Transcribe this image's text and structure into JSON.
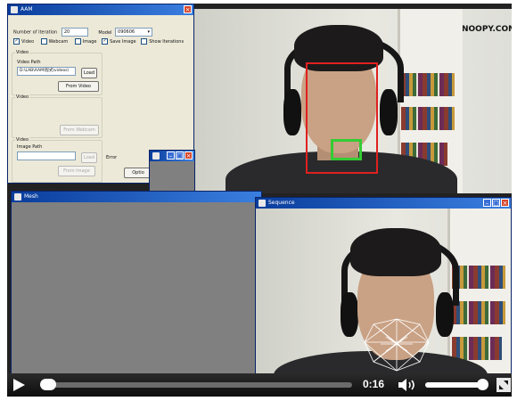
{
  "aam_window": {
    "title": "AAM",
    "iterations_label": "Number of iteration",
    "iterations_value": "20",
    "model_label": "Model",
    "model_value": "090606",
    "checkboxes": [
      {
        "label": "Video",
        "checked": true
      },
      {
        "label": "Webcam",
        "checked": false
      },
      {
        "label": "Image",
        "checked": false
      },
      {
        "label": "Save Image",
        "checked": true
      },
      {
        "label": "Show Iterations",
        "checked": false
      }
    ],
    "video_group_label": "Video",
    "video_path_label": "Video Path",
    "video_path_value": "D:\\LAB\\AAM\\程式\\videos\\",
    "load_label": "Load",
    "from_video_label": "From Video",
    "webcam_group_label": "Video",
    "from_webcam_label": "From Webcam",
    "image_group_label": "Video",
    "image_path_label": "Image Path",
    "load2_label": "Load",
    "from_image_label": "From Image",
    "error_label": "Error",
    "options_label": "Optio"
  },
  "mesh_window": {
    "title": "Mesh"
  },
  "sequence_window": {
    "title": "Sequence"
  },
  "small_window": {
    "title": ""
  },
  "scene": {
    "wall_text": "NOOPY.COM"
  },
  "player": {
    "time": "0:16",
    "progress": 0.0,
    "volume": 0.9
  },
  "colors": {
    "titlebar": "#0a3d9c",
    "face_box": "#e02020",
    "mouth_box": "#33cc33",
    "mesh_lines": "#ffffff"
  }
}
